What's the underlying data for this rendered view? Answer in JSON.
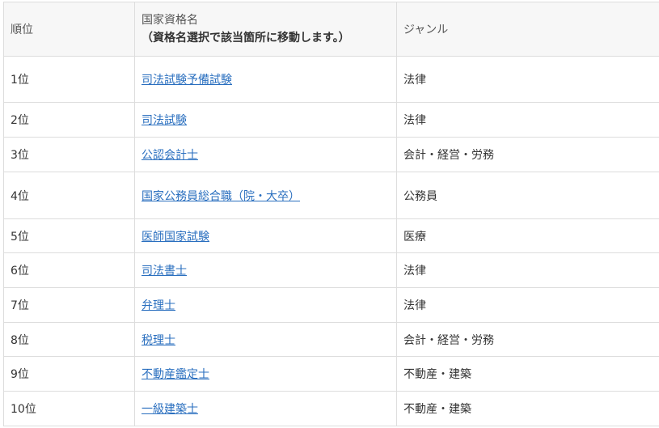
{
  "table": {
    "headers": {
      "rank": "順位",
      "qualification": "国家資格名",
      "qualification_note": "（資格名選択で該当箇所に移動します。）",
      "genre": "ジャンル"
    },
    "rows": [
      {
        "rank": "1位",
        "name": "司法試験予備試験",
        "genre": "法律"
      },
      {
        "rank": "2位",
        "name": "司法試験",
        "genre": "法律"
      },
      {
        "rank": "3位",
        "name": "公認会計士",
        "genre": "会計・経営・労務"
      },
      {
        "rank": "4位",
        "name": "国家公務員総合職（院・大卒）",
        "genre": "公務員"
      },
      {
        "rank": "5位",
        "name": "医師国家試験",
        "genre": "医療"
      },
      {
        "rank": "6位",
        "name": "司法書士",
        "genre": "法律"
      },
      {
        "rank": "7位",
        "name": "弁理士",
        "genre": "法律"
      },
      {
        "rank": "8位",
        "name": "税理士",
        "genre": "会計・経営・労務"
      },
      {
        "rank": "9位",
        "name": "不動産鑑定士",
        "genre": "不動産・建築"
      },
      {
        "rank": "10位",
        "name": "一級建築士",
        "genre": "不動産・建築"
      }
    ]
  }
}
